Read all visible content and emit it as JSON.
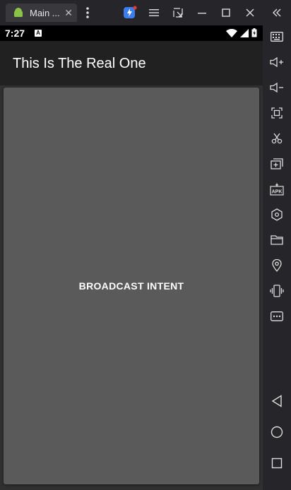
{
  "window": {
    "tab_title": "Main ...",
    "tab_close": "✕"
  },
  "statusbar": {
    "time": "7:27",
    "notification_badge": "A"
  },
  "app": {
    "title": "This Is The Real One",
    "button_label": "BROADCAST INTENT"
  },
  "sidebar": {
    "apk_label": "APK"
  },
  "colors": {
    "app_bar": "#212121",
    "button": "#5a5a5a",
    "frame": "#26262a",
    "accent_badge": "#e53935",
    "accent_blue": "#3b7ded"
  }
}
